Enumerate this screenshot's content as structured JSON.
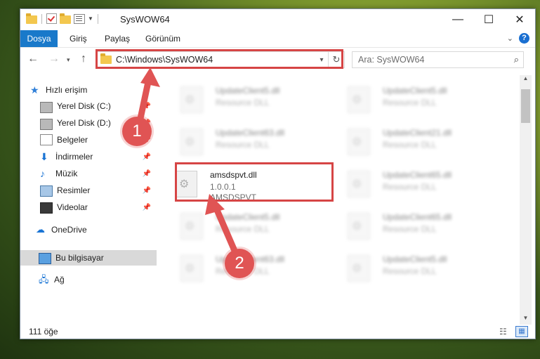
{
  "window": {
    "title": "SysWOW64",
    "min_glyph": "—",
    "max_glyph": "☐",
    "close_glyph": "✕"
  },
  "ribbon": {
    "tabs": [
      "Dosya",
      "Giriş",
      "Paylaş",
      "Görünüm"
    ],
    "accent": "#1979ca"
  },
  "nav": {
    "back": "←",
    "forward": "→",
    "history": "▾",
    "up": "↑",
    "address": "C:\\Windows\\SysWOW64",
    "refresh": "↻",
    "search_placeholder": "Ara: SysWOW64",
    "search_icon": "⌕"
  },
  "sidebar": {
    "items": [
      {
        "label": "Hızlı erişim",
        "icon": "star-icon",
        "pinned": false
      },
      {
        "label": "Yerel Disk (C:)",
        "icon": "disk-icon",
        "pinned": true
      },
      {
        "label": "Yerel Disk (D:)",
        "icon": "disk-icon",
        "pinned": true
      },
      {
        "label": "Belgeler",
        "icon": "documents-icon",
        "pinned": true
      },
      {
        "label": "İndirmeler",
        "icon": "downloads-icon",
        "pinned": true
      },
      {
        "label": "Müzik",
        "icon": "music-icon",
        "pinned": true
      },
      {
        "label": "Resimler",
        "icon": "pictures-icon",
        "pinned": true
      },
      {
        "label": "Videolar",
        "icon": "videos-icon",
        "pinned": true
      },
      {
        "label": "OneDrive",
        "icon": "onedrive-icon",
        "pinned": false
      },
      {
        "label": "Bu bilgisayar",
        "icon": "this-pc-icon",
        "pinned": false,
        "selected": true
      },
      {
        "label": "Ağ",
        "icon": "network-icon",
        "pinned": false
      }
    ],
    "pin_glyph": "📌"
  },
  "files": {
    "left": [
      {
        "name": "UpdateClient5.dll",
        "desc": "Resource DLL"
      },
      {
        "name": "UpdateClient63.dll",
        "desc": "Resource DLL"
      },
      {
        "name": "amsdspvt.dll",
        "version": "1.0.0.1",
        "product": "AMSDSPVT",
        "highlighted": true
      },
      {
        "name": "UpdateClient5.dll",
        "desc": "Resource DLL"
      },
      {
        "name": "UpdateClient63.dll",
        "desc": "Resource DLL"
      }
    ],
    "right": [
      {
        "name": "UpdateClient5.dll",
        "desc": "Resource DLL"
      },
      {
        "name": "UpdateClient21.dll",
        "desc": "Resource DLL"
      },
      {
        "name": "UpdateClient65.dll",
        "desc": "Resource DLL"
      },
      {
        "name": "UpdateClient65.dll",
        "desc": "Resource DLL"
      },
      {
        "name": "UpdateClient5.dll",
        "desc": "Resource DLL"
      }
    ]
  },
  "status": {
    "item_count": "111 öğe"
  },
  "annotations": {
    "callout1": "1",
    "callout2": "2",
    "color": "#d64545"
  }
}
